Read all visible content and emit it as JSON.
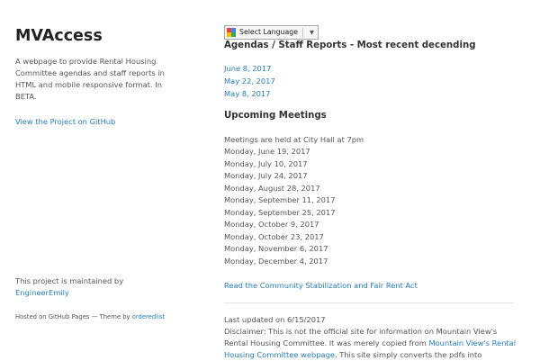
{
  "header": {
    "title": "MVAccess",
    "description": "A webpage to provide Rental Housing Committee agendas and staff reports in HTML and mobile responsive format. In BETA.",
    "github_link": "View the Project on GitHub",
    "maintainer_prefix": "This project is maintained by",
    "maintainer_name": "EngineerEmily",
    "hosted_prefix": "Hosted on GitHub Pages — Theme by",
    "theme_name": "orderedlist"
  },
  "translate": {
    "label": "Select Language",
    "arrow": "▼",
    "icon": "google-translate-icon"
  },
  "agendas": {
    "heading": "Agendas / Staff Reports - Most recent decending",
    "items": [
      "June 8, 2017",
      "May 22, 2017",
      "May 8, 2017"
    ]
  },
  "upcoming": {
    "heading": "Upcoming Meetings",
    "note": "Meetings are held at City Hall at 7pm",
    "dates": [
      "Monday, June 19, 2017",
      "Monday, July 10, 2017",
      "Monday, July 24, 2017",
      "Monday, August 28, 2017",
      "Monday, September 11, 2017",
      "Monday, September 25, 2017",
      "Monday, October 9, 2017",
      "Monday, October 23, 2017",
      "Monday, November 6, 2017",
      "Monday, December 4, 2017"
    ]
  },
  "community_link": "Read the Community Stabilization and Fair Rent Act",
  "footer": {
    "updated": "Last updated on 6/15/2017",
    "disclaimer_1": "Disclaimer: This is not the official site for information on Mountain View's Rental Housing Committee. It was merely copied from",
    "disclaimer_link": "Mountain View's Rental Housing Committee webpage",
    "disclaimer_2": ". This site simply converts the pdfs into"
  },
  "colors": {
    "link": "#267cb9",
    "text": "#555555",
    "heading": "#222222"
  }
}
